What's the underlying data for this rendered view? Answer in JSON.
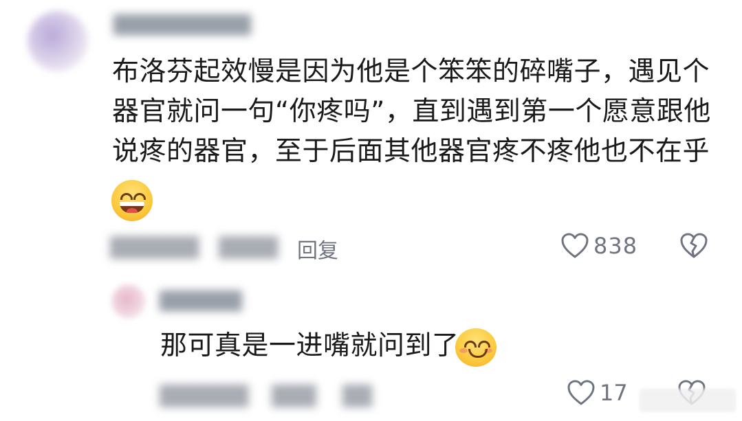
{
  "main_comment": {
    "username": "██████████",
    "text": "布洛芬起效慢是因为他是个笨笨的碎嘴子，遇见个器官就问一句“你疼吗”，直到遇到第一个愿意跟他说疼的器官，至于后面其他器官疼不疼他也不在乎",
    "emoji": "grinning-face-emoji",
    "time_blurred": "██████",
    "location_blurred": "████",
    "reply_label": "回复",
    "like_count": "838",
    "like_icon": "heart-outline-icon",
    "dislike_icon": "broken-heart-icon"
  },
  "reply_comment": {
    "username": "██████",
    "text": "那可真是一进嘴就问到了",
    "emoji": "smiling-face-emoji",
    "time_blurred": "██████",
    "location_blurred": "███",
    "reply_blurred": "██",
    "like_count": "17",
    "like_icon": "heart-outline-icon",
    "dislike_icon": "broken-heart-icon"
  },
  "colors": {
    "text": "#1a1a1a",
    "meta": "#6f7480",
    "background": "#ffffff"
  }
}
